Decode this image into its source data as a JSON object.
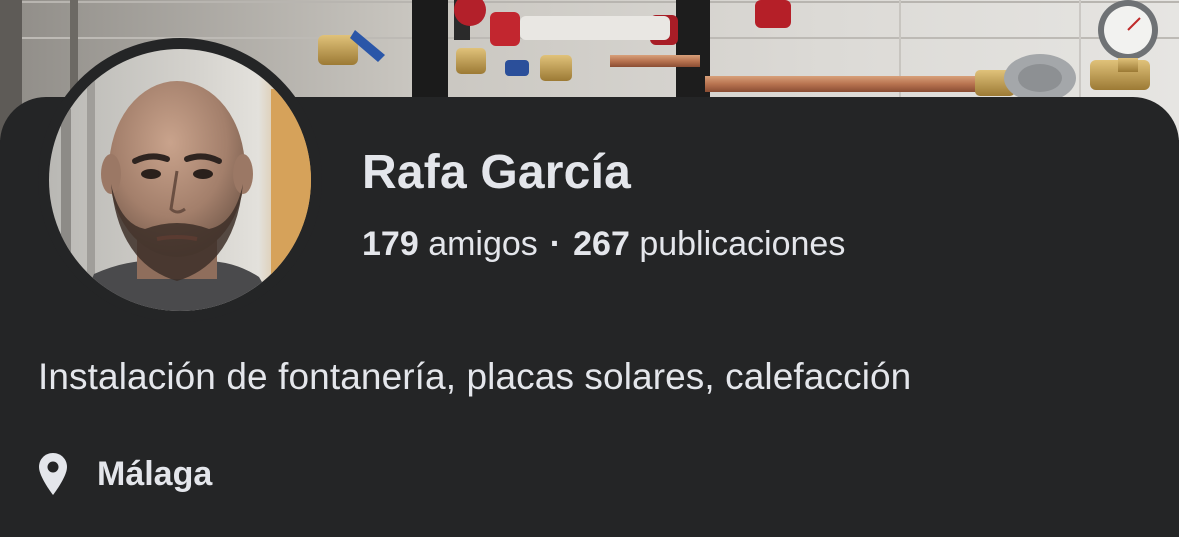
{
  "profile": {
    "name": "Rafa García",
    "friends_count": "179",
    "friends_label": "amigos",
    "separator": "·",
    "posts_count": "267",
    "posts_label": "publicaciones",
    "bio": "Instalación de fontanería, placas solares, calefacción",
    "location": "Málaga",
    "location_icon": "map-pin-icon"
  },
  "colors": {
    "background": "#242526",
    "text": "#e4e6eb"
  }
}
